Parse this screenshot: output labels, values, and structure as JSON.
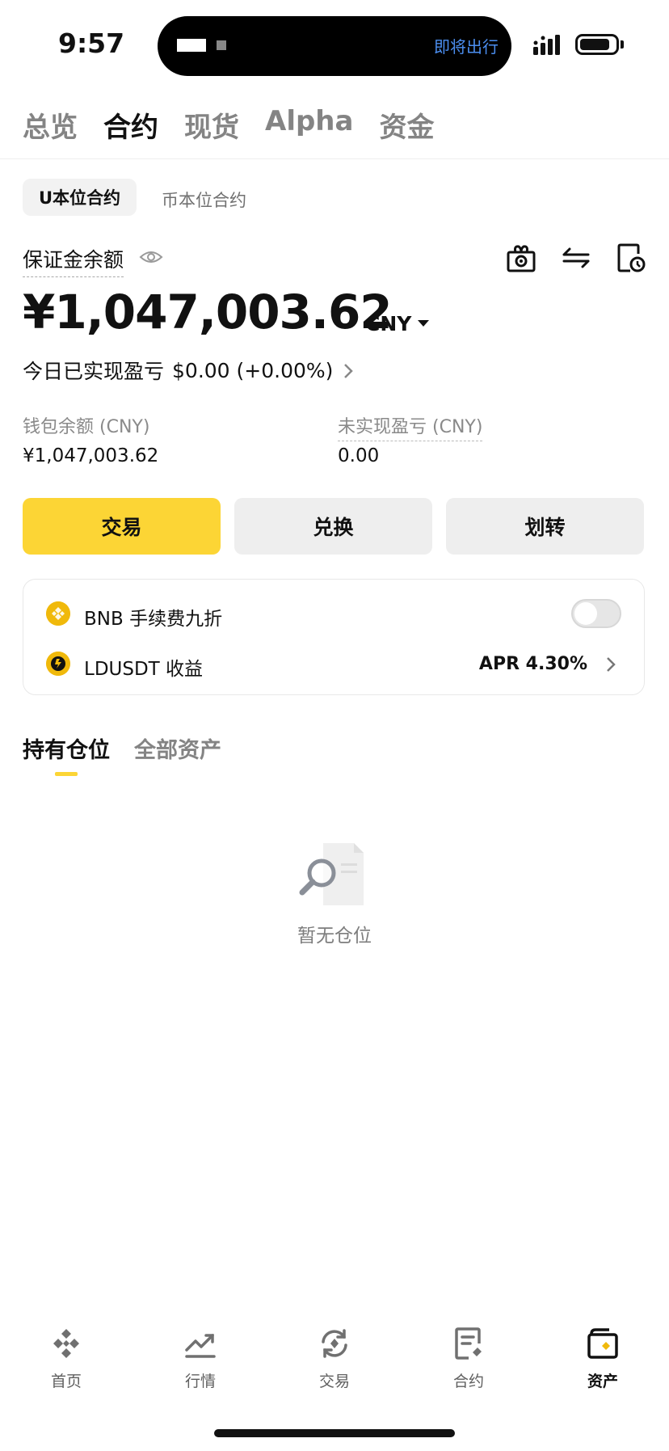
{
  "status_bar": {
    "time": "9:57",
    "island_text": "即将出行"
  },
  "top_tabs": [
    {
      "label": "总览",
      "active": false
    },
    {
      "label": "合约",
      "active": true
    },
    {
      "label": "现货",
      "active": false
    },
    {
      "label": "Alpha",
      "active": false
    },
    {
      "label": "资金",
      "active": false
    }
  ],
  "sub_tabs": {
    "active": "U本位合约",
    "inactive": "币本位合约"
  },
  "margin": {
    "label": "保证金余额",
    "balance": "¥1,047,003.62",
    "currency": "CNY",
    "today_pnl_label": "今日已实现盈亏",
    "today_pnl_value": "$0.00 (+0.00%)",
    "icons": [
      "gift-icon",
      "transfer-arrows-icon",
      "history-icon"
    ]
  },
  "stats": {
    "wallet_label": "钱包余额 (CNY)",
    "wallet_value": "¥1,047,003.62",
    "unrealized_label": "未实现盈亏 (CNY)",
    "unrealized_value": "0.00"
  },
  "actions": {
    "trade": "交易",
    "convert": "兑换",
    "transfer": "划转"
  },
  "card": {
    "bnb_label": "BNB 手续费九折",
    "bnb_toggle_on": false,
    "ldusdt_label": "LDUSDT 收益",
    "apr": "APR 4.30%"
  },
  "position_tabs": {
    "holdings": "持有仓位",
    "all_assets": "全部资产"
  },
  "empty_state": {
    "text": "暂无仓位"
  },
  "bottom_nav": [
    {
      "label": "首页",
      "icon": "home-icon",
      "active": false
    },
    {
      "label": "行情",
      "icon": "markets-icon",
      "active": false
    },
    {
      "label": "交易",
      "icon": "trade-icon",
      "active": false
    },
    {
      "label": "合约",
      "icon": "futures-icon",
      "active": false
    },
    {
      "label": "资产",
      "icon": "wallet-icon",
      "active": true
    }
  ],
  "colors": {
    "accent": "#fcd535",
    "coin": "#f0b90b",
    "island_text": "#4b8ef0"
  }
}
